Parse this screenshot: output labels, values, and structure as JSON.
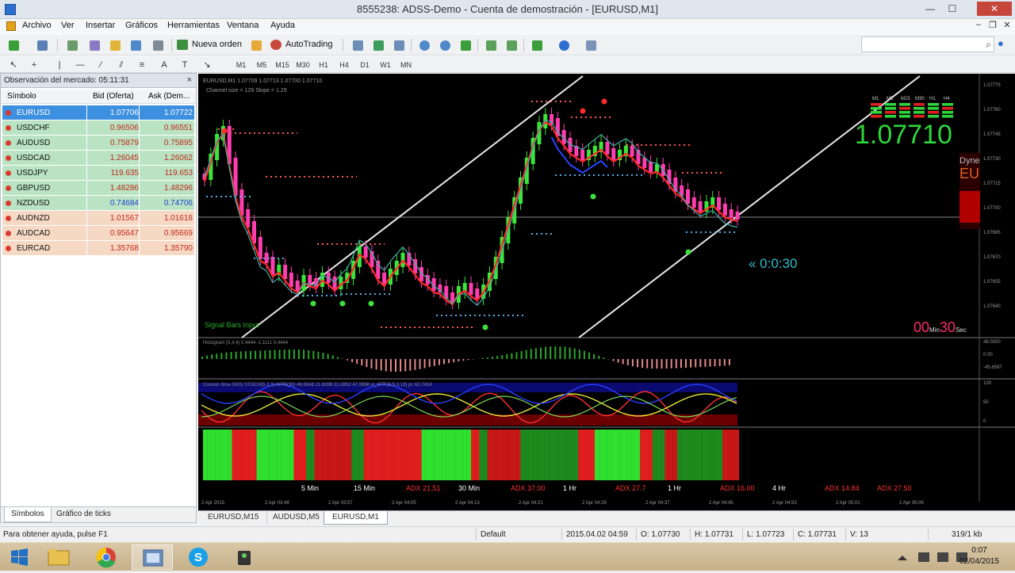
{
  "window": {
    "title": "8555238: ADSS-Demo - Cuenta de demostración - [EURUSD,M1]",
    "minimize": "—",
    "maximize": "☐",
    "close": "✕"
  },
  "menu": {
    "items": [
      "Archivo",
      "Ver",
      "Insertar",
      "Gráficos",
      "Herramientas",
      "Ventana",
      "Ayuda"
    ],
    "mdi_minimize": "–",
    "mdi_restore": "❐",
    "mdi_close": "✕"
  },
  "toolbar": {
    "new_order": "Nueva orden",
    "autotrading": "AutoTrading",
    "search_placeholder": "",
    "search_icon": "⌕"
  },
  "timeframes": [
    "M1",
    "M5",
    "M15",
    "M30",
    "H1",
    "H4",
    "D1",
    "W1",
    "MN"
  ],
  "market_watch": {
    "header": "Observación del mercado: 05:11:31",
    "close": "×",
    "columns": {
      "symbol": "Símbolo",
      "bid": "Bid (Oferta)",
      "ask": "Ask (Dem..."
    },
    "rows": [
      {
        "symbol": "EURUSD",
        "bid": "1.07706",
        "ask": "1.07722",
        "selected": true
      },
      {
        "symbol": "USDCHF",
        "bid": "0.96506",
        "ask": "0.96551"
      },
      {
        "symbol": "AUDUSD",
        "bid": "0.75879",
        "ask": "0.75895"
      },
      {
        "symbol": "USDCAD",
        "bid": "1.26045",
        "ask": "1.26062"
      },
      {
        "symbol": "USDJPY",
        "bid": "119.635",
        "ask": "119.653"
      },
      {
        "symbol": "GBPUSD",
        "bid": "1.48286",
        "ask": "1.48296"
      },
      {
        "symbol": "NZDUSD",
        "bid": "0.74684",
        "ask": "0.74706",
        "blue": true
      },
      {
        "symbol": "AUDNZD",
        "bid": "1.01567",
        "ask": "1.01618",
        "light": true
      },
      {
        "symbol": "AUDCAD",
        "bid": "0.95647",
        "ask": "0.95669",
        "light": true
      },
      {
        "symbol": "EURCAD",
        "bid": "1.35768",
        "ask": "1.35790",
        "light": true
      }
    ],
    "tabs": [
      "Símbolos",
      "Gráfico de ticks"
    ]
  },
  "chart": {
    "header_line1": "EURUSD,M1  1.07709 1.07713 1.07700 1.07710",
    "header_line2": "Channel size = 129 Slope = 1.29",
    "big_price": "1.07710",
    "countdown": "« 0:0:30",
    "timer_min": "00",
    "timer_min_unit": "Min",
    "timer_sec": "30",
    "timer_sec_unit": "Sec",
    "signal_label": "Signal Bars Input",
    "panel_label": "Dyne",
    "panel_symbol": "EU",
    "histogram_label": "Histogram (5,4,4) 0.4444 -1.1111 0.4444",
    "osc_label": "Custom Sma 30(0)  STOCH(5,3,3)  WPR(30) 46.6346 21.6398 21.0852 47.0898  xl_MTF(8,5,3,13)  pi:  62.7418",
    "strength_labels": [
      "5 Min",
      "15 Min",
      "ADX 21.51",
      "30 Min",
      "ADX 37.00",
      "1 Hr",
      "ADX 27.7",
      "1 Hr",
      "ADX 16.00",
      "4 Hr",
      "ADX 14.84",
      "ADX 27.50"
    ],
    "time_labels": [
      "2 Apr 2015",
      "2 Apr 03:49",
      "2 Apr 03:57",
      "2 Apr 04:05",
      "2 Apr 04:13",
      "2 Apr 04:21",
      "2 Apr 04:29",
      "2 Apr 04:37",
      "2 Apr 04:45",
      "2 Apr 04:53",
      "2 Apr 05:01",
      "2 Apr 05:09"
    ],
    "price_ticks": [
      "1.07775",
      "1.07760",
      "1.07745",
      "1.07730",
      "1.07715",
      "1.07700",
      "1.07685",
      "1.07670",
      "1.07655",
      "1.07640"
    ],
    "hist_ticks": [
      "48.0000",
      "0.00",
      "-45.6597"
    ],
    "osc_ticks": [
      "100",
      "50",
      "0"
    ],
    "mtf_labels": [
      "M1",
      "M5",
      "M15",
      "M30",
      "H1",
      "H4"
    ]
  },
  "chart_tabs": [
    "EURUSD,M15",
    "AUDUSD,M5",
    "EURUSD,M1"
  ],
  "status": {
    "help": "Para obtener ayuda, pulse F1",
    "profile": "Default",
    "datetime": "2015.04.02 04:59",
    "open": "O: 1.07730",
    "high": "H: 1.07731",
    "low": "L: 1.07723",
    "close": "C: 1.07731",
    "volume": "V: 13",
    "traffic": "319/1 kb"
  },
  "taskbar": {
    "apps": [
      "file-explorer",
      "chrome",
      "metatrader",
      "skype",
      "recorder"
    ],
    "time": "0:07",
    "date": "02/04/2015"
  }
}
